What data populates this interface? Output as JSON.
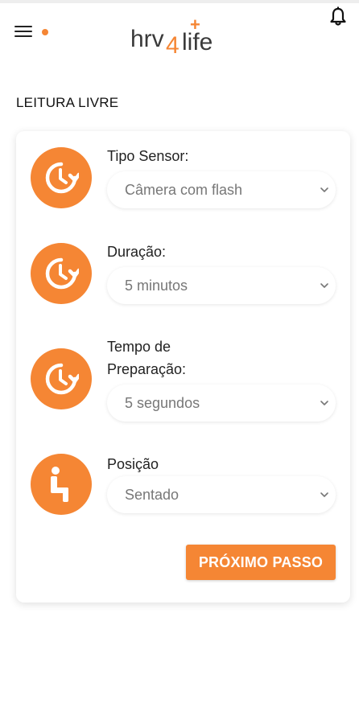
{
  "header": {
    "logo_text_left": "hrv",
    "logo_text_num": "4",
    "logo_text_right": "life",
    "logo_plus": "+",
    "menu_icon": "hamburger-menu-icon",
    "notification_icon": "bell-icon"
  },
  "page": {
    "title": "LEITURA LIVRE"
  },
  "form": {
    "fields": [
      {
        "label": "Tipo Sensor:",
        "value": "Câmera com flash",
        "icon": "clock-refresh-icon"
      },
      {
        "label": "Duração:",
        "value": "5 minutos",
        "icon": "clock-refresh-icon"
      },
      {
        "label": "Tempo de Preparação:",
        "value": "5 segundos",
        "icon": "clock-refresh-icon"
      },
      {
        "label": "Posição",
        "value": "Sentado",
        "icon": "seated-person-icon"
      }
    ],
    "next_button_label": "PRÓXIMO PASSO"
  },
  "colors": {
    "accent": "#F58634",
    "text_dark": "#222222",
    "placeholder": "#777777",
    "logo_grey": "#3a3a3a"
  }
}
